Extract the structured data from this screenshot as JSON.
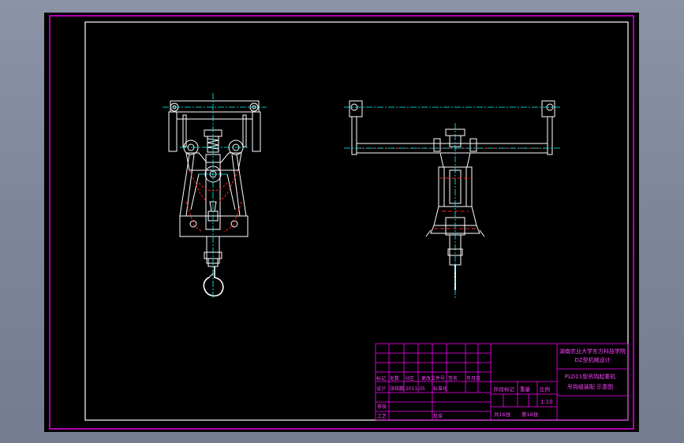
{
  "colors": {
    "background": "#000000",
    "frame": "#ff00ff",
    "drawing_lines": "#ffffff",
    "center_lines": "#00ffff",
    "hidden_lines": "#ff2020",
    "desktop": "#7d8699"
  },
  "title_block": {
    "school": "湖南农业大学东方科技学院",
    "course": "DZ型机械设计",
    "drawing_title_line1": "PLD11型吊钩起重机",
    "drawing_title_line2": "吊钩组装配 示意图",
    "label_mark": "标记",
    "label_count": "处数",
    "label_zone": "分区",
    "label_change_doc": "更改文件号",
    "label_sign": "签名",
    "label_date": "年月日",
    "label_design": "设计",
    "designer": "张晓鹏",
    "design_date": "2011.05",
    "label_standard": "标准化",
    "label_stage_mark": "阶段标记",
    "label_weight": "重量",
    "label_scale": "比例",
    "scale_value": "1:10",
    "label_review": "审核",
    "label_process": "工艺",
    "label_approve": "批准",
    "sheets_total": "共16张",
    "sheet_no": "第16张"
  }
}
